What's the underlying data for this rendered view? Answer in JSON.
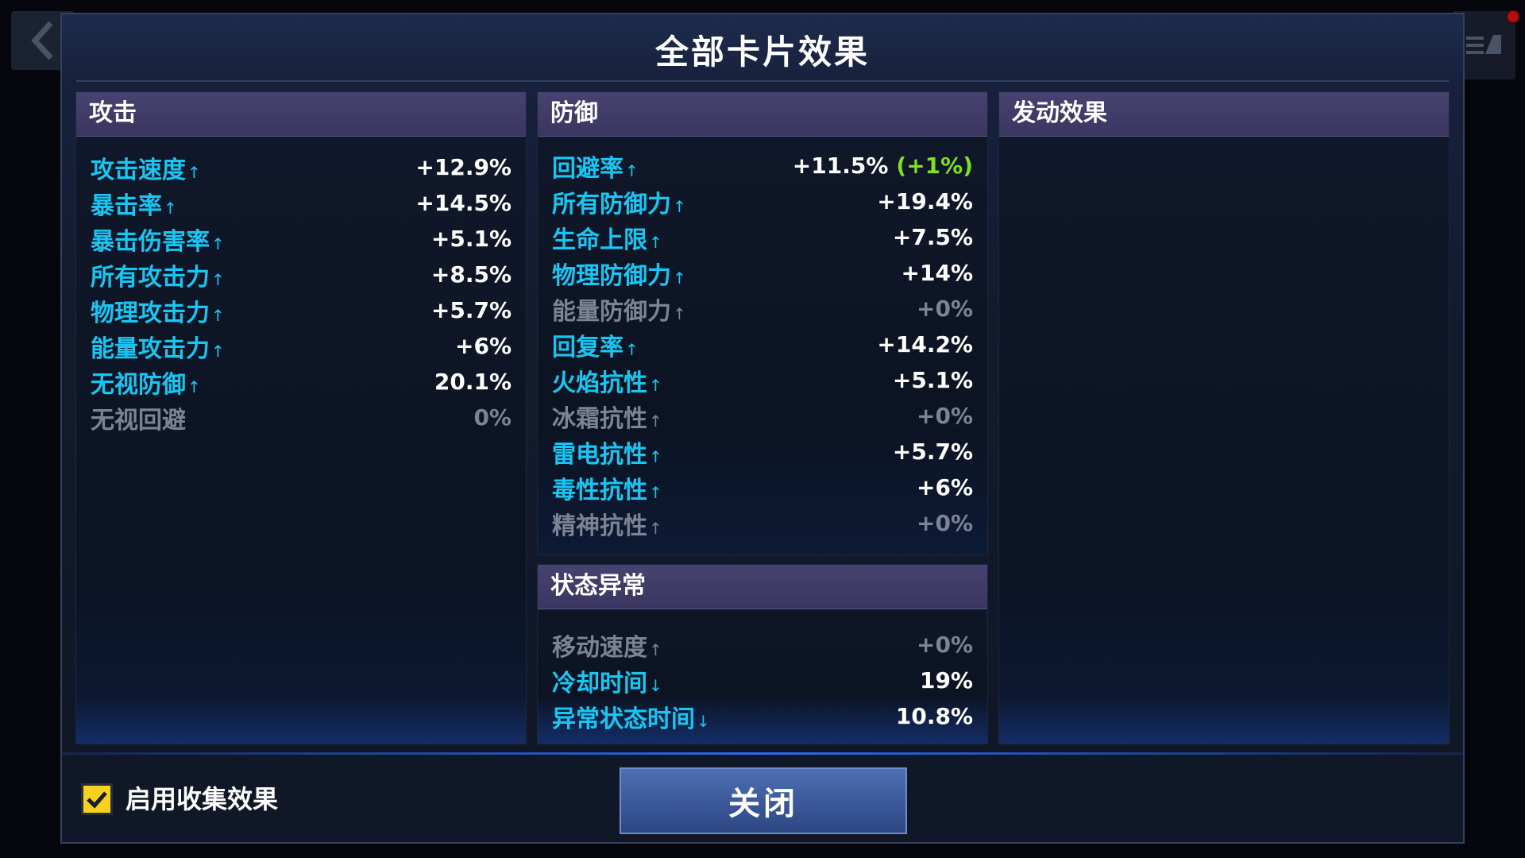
{
  "title": "全部卡片效果",
  "attack": {
    "header": "攻击",
    "stats": [
      {
        "label": "攻击速度",
        "arrow": "↑",
        "value": "+12.9%",
        "active": true
      },
      {
        "label": "暴击率",
        "arrow": "↑",
        "value": "+14.5%",
        "active": true
      },
      {
        "label": "暴击伤害率",
        "arrow": "↑",
        "value": "+5.1%",
        "active": true
      },
      {
        "label": "所有攻击力",
        "arrow": "↑",
        "value": "+8.5%",
        "active": true
      },
      {
        "label": "物理攻击力",
        "arrow": "↑",
        "value": "+5.7%",
        "active": true
      },
      {
        "label": "能量攻击力",
        "arrow": "↑",
        "value": "+6%",
        "active": true
      },
      {
        "label": "无视防御",
        "arrow": "↑",
        "value": "20.1%",
        "active": true
      },
      {
        "label": "无视回避",
        "arrow": "",
        "value": "0%",
        "active": false
      }
    ]
  },
  "defense": {
    "header": "防御",
    "stats": [
      {
        "label": "回避率",
        "arrow": "↑",
        "value": "+11.5%",
        "bonus": "(+1%)",
        "active": true
      },
      {
        "label": "所有防御力",
        "arrow": "↑",
        "value": "+19.4%",
        "active": true
      },
      {
        "label": "生命上限",
        "arrow": "↑",
        "value": "+7.5%",
        "active": true
      },
      {
        "label": "物理防御力",
        "arrow": "↑",
        "value": "+14%",
        "active": true
      },
      {
        "label": "能量防御力",
        "arrow": "↑",
        "value": "+0%",
        "active": false
      },
      {
        "label": "回复率",
        "arrow": "↑",
        "value": "+14.2%",
        "active": true
      },
      {
        "label": "火焰抗性",
        "arrow": "↑",
        "value": "+5.1%",
        "active": true
      },
      {
        "label": "冰霜抗性",
        "arrow": "↑",
        "value": "+0%",
        "active": false
      },
      {
        "label": "雷电抗性",
        "arrow": "↑",
        "value": "+5.7%",
        "active": true
      },
      {
        "label": "毒性抗性",
        "arrow": "↑",
        "value": "+6%",
        "active": true
      },
      {
        "label": "精神抗性",
        "arrow": "↑",
        "value": "+0%",
        "active": false
      }
    ]
  },
  "status": {
    "header": "状态异常",
    "stats": [
      {
        "label": "移动速度",
        "arrow": "↑",
        "value": "+0%",
        "active": false
      },
      {
        "label": "冷却时间",
        "arrow": "↓",
        "value": "19%",
        "active": true
      },
      {
        "label": "异常状态时间",
        "arrow": "↓",
        "value": "10.8%",
        "active": true
      }
    ]
  },
  "activation": {
    "header": "发动效果"
  },
  "footer": {
    "checkbox_label": "启用收集效果",
    "checkbox_checked": true,
    "close_label": "关闭"
  },
  "colors": {
    "active_label": "#18c6f3",
    "inactive": "#7c8393",
    "bonus": "#7fe01f",
    "header_bg": "#47426f",
    "checkbox": "#f6d21e"
  },
  "icons": {
    "back": "chevron-left-icon",
    "menu": "menu-icon",
    "check": "checkmark-icon"
  }
}
